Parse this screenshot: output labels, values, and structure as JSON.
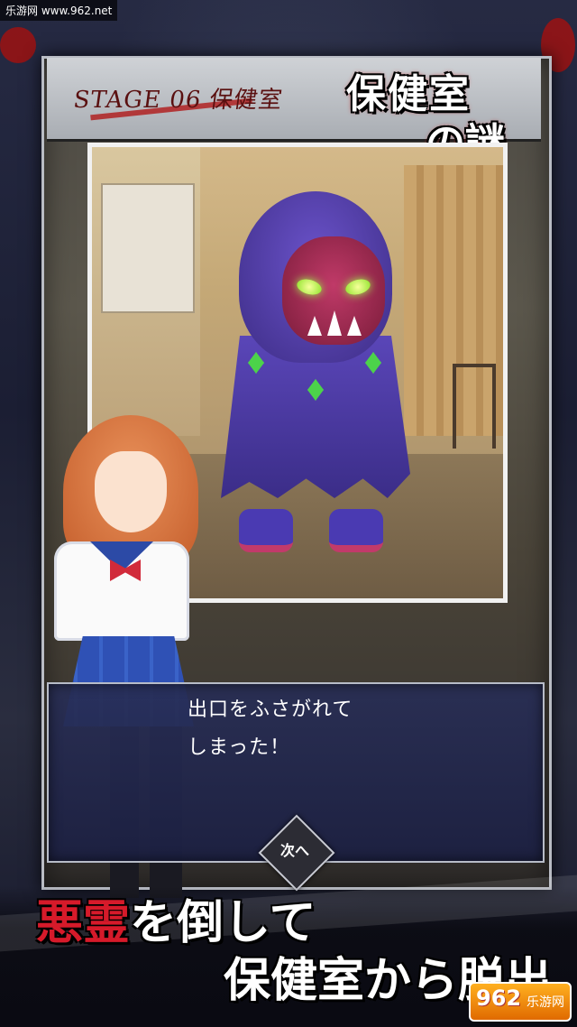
{
  "watermark_top": "乐游网 www.962.net",
  "stage": {
    "label": "STAGE 06 保健室"
  },
  "title": {
    "line1": "保健室",
    "line2": "の謎"
  },
  "dialog": {
    "text": "出口をふさがれて\nしまった！"
  },
  "next_button": {
    "label": "次へ"
  },
  "promo": {
    "line1_accent": "悪霊",
    "line1_rest": "を倒して",
    "line2": "保健室から脱出"
  },
  "watermark_logo": {
    "number": "962",
    "text": "乐游网"
  },
  "colors": {
    "accent_red": "#d61a2a",
    "dialog_bg": "#282e56",
    "monster_purple": "#5a46b8"
  }
}
